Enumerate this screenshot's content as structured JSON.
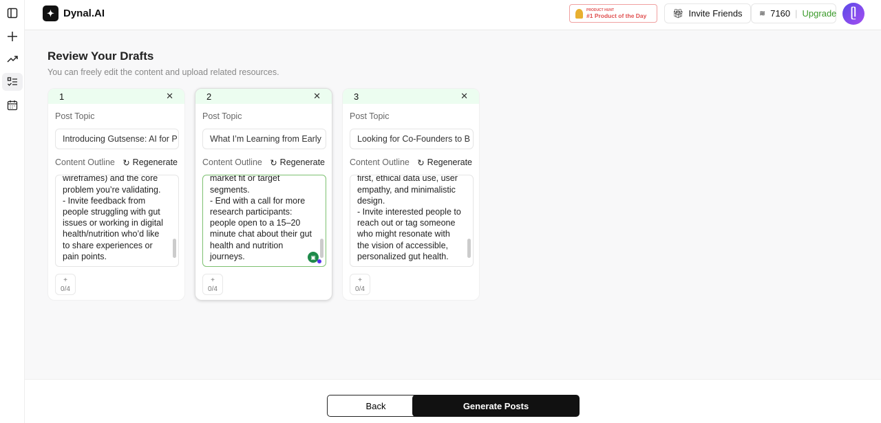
{
  "sidebar": {
    "items": [
      {
        "icon": "sidebar-toggle-icon"
      },
      {
        "icon": "plus-icon"
      },
      {
        "icon": "trending-icon"
      },
      {
        "icon": "checklist-icon",
        "active": true
      },
      {
        "icon": "calendar-icon"
      }
    ]
  },
  "header": {
    "logo": "Dynal.AI",
    "ph_small": "PRODUCT HUNT",
    "ph_label": "#1 Product of the Day",
    "invite": "Invite Friends",
    "credits": "7160",
    "upgrade": "Upgrade",
    "upgrade_color": "#3a9a2a"
  },
  "main": {
    "title": "Review Your Drafts",
    "subtitle": "You can freely edit the content and upload related resources.",
    "post_topic_label": "Post Topic",
    "outline_label": "Content Outline",
    "regenerate": "Regenerate",
    "cards": [
      {
        "num": "1",
        "topic": "Introducing Gutsense: AI for P",
        "outline": "wireframes) and the core\nproblem you’re validating.\n- Invite feedback from\npeople struggling with gut\nissues or working in digital\nhealth/nutrition who’d like\nto share experiences or\npain points.",
        "uploads": "0/4"
      },
      {
        "num": "2",
        "topic": "What I’m Learning from Early",
        "outline": "market fit or target\nsegments.\n- End with a call for more\nresearch participants:\npeople open to a 15–20\nminute chat about their gut\nhealth and nutrition\njourneys.",
        "uploads": "0/4"
      },
      {
        "num": "3",
        "topic": "Looking for Co-Founders to B",
        "outline": "first, ethical data use, user\nempathy, and minimalistic\ndesign.\n- Invite interested people to\nreach out or tag someone\nwho might resonate with\nthe vision of accessible,\npersonalized gut health.",
        "uploads": "0/4"
      }
    ]
  },
  "footer": {
    "back": "Back",
    "generate": "Generate Posts"
  }
}
